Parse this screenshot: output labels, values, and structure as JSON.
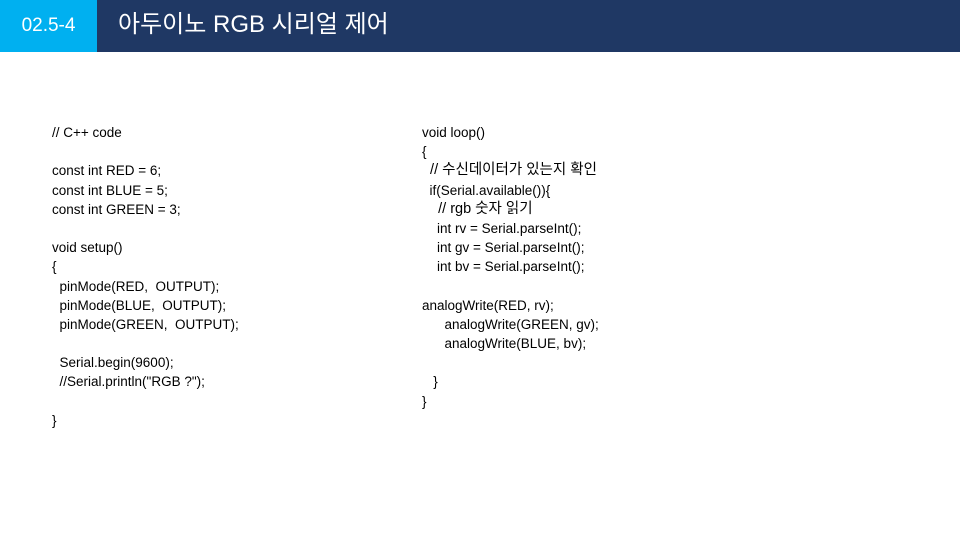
{
  "header": {
    "badge": "02.5-4",
    "title": "아두이노 RGB 시리얼 제어"
  },
  "code_left": [
    "// C++ code",
    "",
    "const int RED = 6;",
    "const int BLUE = 5;",
    "const int GREEN = 3;",
    "",
    "void setup()",
    "{",
    "  pinMode(RED,  OUTPUT);",
    "  pinMode(BLUE,  OUTPUT);",
    "  pinMode(GREEN,  OUTPUT);",
    "",
    "  Serial.begin(9600);",
    "  //Serial.println(\"RGB ?\");",
    "",
    "}"
  ],
  "code_right": [
    "void loop()",
    "{",
    "  // 수신데이터가 있는지 확인",
    "  if(Serial.available()){",
    "    // rgb 숫자 읽기",
    "    int rv = Serial.parseInt();",
    "    int gv = Serial.parseInt();",
    "    int bv = Serial.parseInt();",
    "",
    "analogWrite(RED, rv);",
    "      analogWrite(GREEN, gv);",
    "      analogWrite(BLUE, bv);",
    "",
    "   }",
    "}"
  ]
}
